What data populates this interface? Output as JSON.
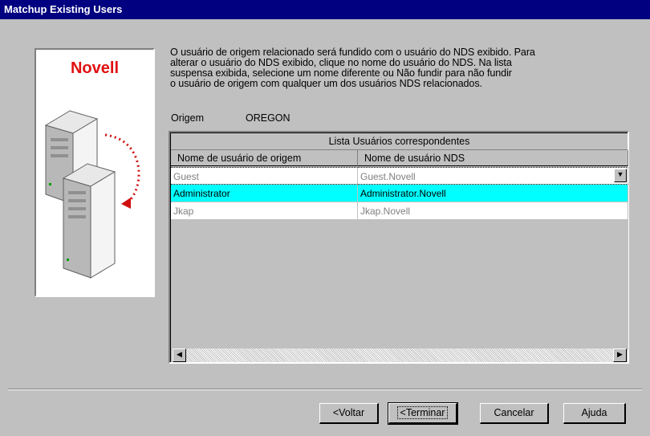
{
  "window": {
    "title": "Matchup Existing Users"
  },
  "brand": {
    "name": "Novell",
    "color": "#e01010"
  },
  "instructions": [
    "O usuário de origem relacionado será fundido com o usuário do NDS exibido. Para",
    "alterar o usuário do NDS exibido, clique no nome do usuário do NDS. Na lista",
    "suspensa exibida, selecione um nome diferente ou Não fundir para não fundir",
    "o usuário de origem com qualquer um dos usuários NDS relacionados."
  ],
  "origin": {
    "label": "Origem",
    "value": "OREGON"
  },
  "grid": {
    "caption": "Lista Usuários correspondentes",
    "columns": [
      "Nome de usuário de origem",
      "Nome de usuário NDS"
    ],
    "rows": [
      {
        "source": "Guest",
        "nds": "Guest.Novell",
        "state": "plain"
      },
      {
        "source": "Administrator",
        "nds": "Administrator.Novell",
        "state": "selected"
      },
      {
        "source": "Jkap",
        "nds": "Jkap.Novell",
        "state": "plain"
      }
    ],
    "selected_color": "#00ffff"
  },
  "icons": {
    "dropdown": "dropdown-arrow-icon",
    "scroll_left": "scroll-left-arrow-icon",
    "scroll_right": "scroll-right-arrow-icon",
    "servers": "server-migration-illustration"
  },
  "buttons": {
    "back": "<Voltar",
    "finish": "<Terminar",
    "cancel": "Cancelar",
    "help": "Ajuda"
  },
  "colors": {
    "title_bar": "#000080",
    "dialog": "#c0c0c0"
  }
}
